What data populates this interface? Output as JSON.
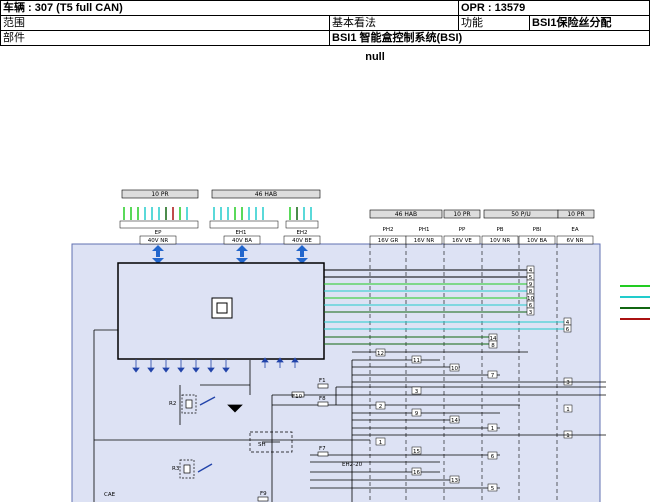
{
  "header": {
    "vehicle": "车辆 : 307 (T5 full CAN)",
    "opr": "OPR : 13579",
    "scope_label": "范围",
    "view": "基本看法",
    "function_label": "功能",
    "function_value": "BSI1保险丝分配",
    "part_label": "部件",
    "part_value": "BSI1 智能盒控制系统(BSI)"
  },
  "status_text": "null",
  "diagram": {
    "top_connectors": [
      {
        "label": "10 PR",
        "pins": "2 4 6 8 10"
      },
      {
        "label": "46 HAB"
      },
      {
        "label": "46 HAB"
      },
      {
        "label": "10 PR"
      },
      {
        "label": "50 P/U"
      },
      {
        "label": "10 PR"
      }
    ],
    "connector_ids": [
      "EP",
      "EH1",
      "EH2",
      "PH2",
      "PH1",
      "PP",
      "PB",
      "PBI",
      "EA"
    ],
    "connector_specs": [
      "40V NR",
      "40V BA",
      "40V BE",
      "16V GR",
      "16V NR",
      "16V VE",
      "10V NR",
      "10V BA",
      "6V NR"
    ],
    "components": [
      "R2",
      "R3",
      "SH"
    ],
    "fuses": [
      "F10",
      "F1",
      "F8",
      "F7",
      "F9"
    ],
    "wire_labels": [
      "EH2-20",
      "CAE"
    ],
    "right_pins": [
      "4",
      "5",
      "9",
      "8",
      "10",
      "6",
      "3",
      "4",
      "6",
      "14",
      "8",
      "3",
      "1",
      "1"
    ],
    "terminal_numbers": [
      "12",
      "11",
      "10",
      "7",
      "3",
      "2",
      "9",
      "14",
      "1",
      "1",
      "15",
      "16",
      "6",
      "5",
      "13"
    ],
    "legend_colors": [
      "#22cc22",
      "#22cccc",
      "#116611",
      "#aa1111"
    ]
  }
}
